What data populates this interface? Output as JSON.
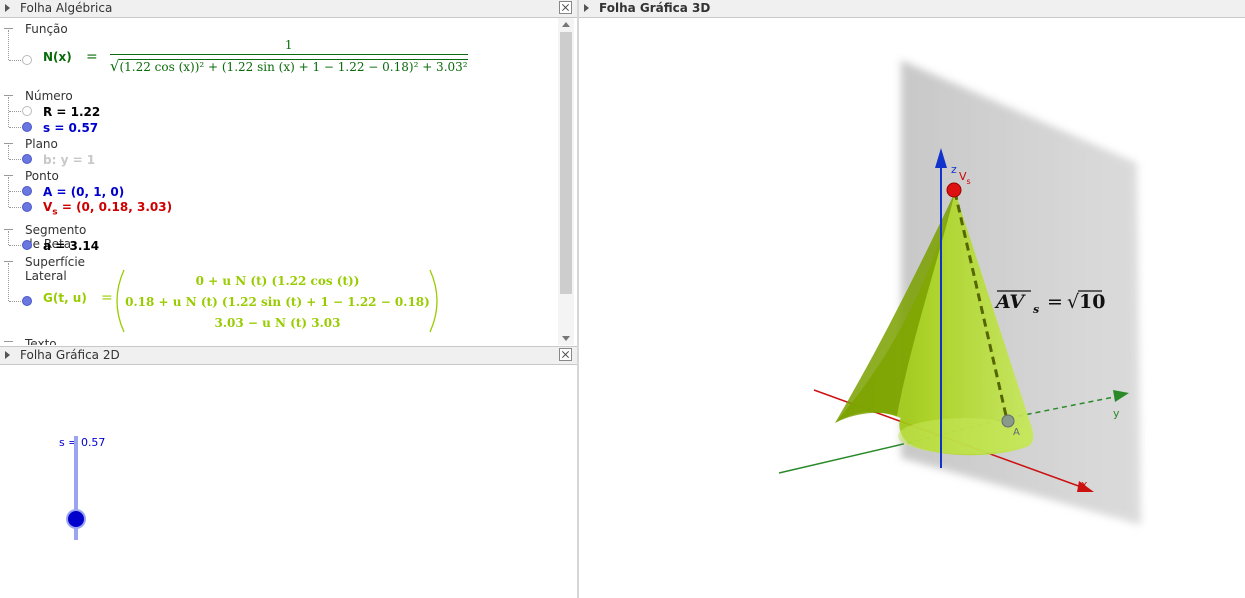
{
  "algebra": {
    "title": "Folha Algébrica",
    "groups": {
      "funcao": "Função",
      "numero": "Número",
      "plano": "Plano",
      "ponto": "Ponto",
      "segmento": "Segmento de Reta",
      "superficie": "Superfície Lateral",
      "partial_next": "Texto"
    },
    "function": {
      "lhs": "N(x)",
      "eq": "=",
      "numerator": "1",
      "denominator": "(1.22  cos (x))² + (1.22 sin (x) + 1 − 1.22 − 0.18)² + 3.03²"
    },
    "numbers": [
      "R = 1.22",
      "s = 0.57"
    ],
    "plane": "b: y = 1",
    "points": [
      "A = (0, 1, 0)",
      "V",
      "s",
      " = (0, 0.18, 3.03)"
    ],
    "segment": "a = 3.14",
    "surface": {
      "lhs": "G(t, u)",
      "eq": "=",
      "row1": "0 + u N (t)  (1.22  cos (t))",
      "row2": "0.18 + u N (t)  (1.22  sin (t) + 1 − 1.22 − 0.18)",
      "row3": "3.03 − u N (t)  3.03"
    }
  },
  "graphics2d": {
    "title": "Folha Gráfica 2D",
    "slider_label": "s = 0.57",
    "slider_value": 0.57
  },
  "graphics3d": {
    "title": "Folha Gráfica 3D",
    "axis_z": "z",
    "axis_y": "y",
    "axis_x": "x",
    "point_a": "A",
    "apex_label": "V",
    "apex_sub": "s",
    "formula_lhs": "AV",
    "formula_sub": "s",
    "formula_eq": "=",
    "formula_rhs": "10"
  },
  "colors": {
    "function_green": "#0a6b0a",
    "number_blue": "#0000cc",
    "point_red": "#cc0000",
    "surface_green": "#99cc00",
    "plane_gray": "#c8c8c8"
  }
}
